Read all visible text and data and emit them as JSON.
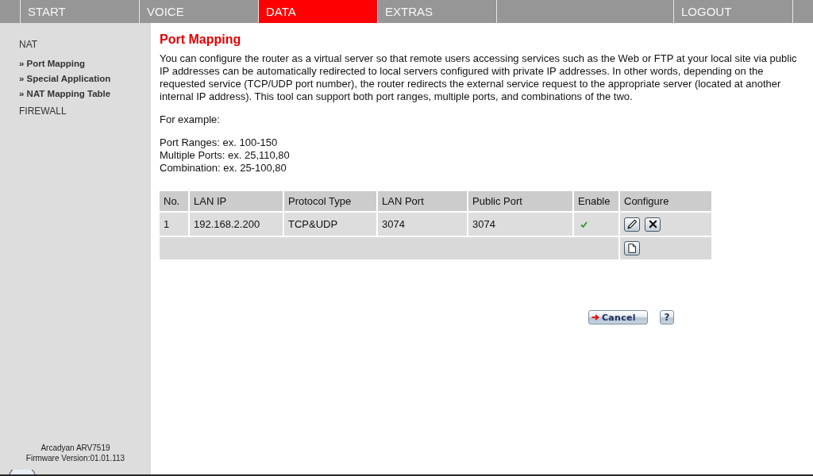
{
  "nav": {
    "tabs": [
      {
        "label": "START",
        "selected": false
      },
      {
        "label": "VOICE",
        "selected": false
      },
      {
        "label": "DATA",
        "selected": true
      },
      {
        "label": "EXTRAS",
        "selected": false
      }
    ],
    "logout": "LOGOUT"
  },
  "sidebar": {
    "sections": [
      {
        "label": "NAT",
        "children": [
          {
            "label": "» Port Mapping"
          },
          {
            "label": "» Special Application"
          },
          {
            "label": "» NAT Mapping Table"
          }
        ]
      },
      {
        "label": "FIREWALL"
      }
    ],
    "device": {
      "model": "Arcadyan ARV7519",
      "firmware": "Firmware Version:01.01.113"
    }
  },
  "content": {
    "title": "Port Mapping",
    "description": "You can configure the router as a virtual server so that remote users accessing services such as the Web or FTP at your local site via public IP addresses can be automatically redirected to local servers configured with private IP addresses. In other words, depending on the requested service (TCP/UDP port number), the router redirects the external service request to the appropriate server (located at another internal IP address). This tool can support both port ranges, multiple ports, and combinations of the two.",
    "example_heading": "For example:",
    "examples": [
      "Port Ranges: ex. 100-150",
      "Multiple Ports: ex. 25,110,80",
      "Combination: ex. 25-100,80"
    ],
    "table": {
      "columns": [
        "No.",
        "LAN IP",
        "Protocol Type",
        "LAN Port",
        "Public Port",
        "Enable",
        "Configure"
      ],
      "rows": [
        {
          "no": "1",
          "lan_ip": "192.168.2.200",
          "protocol": "TCP&UDP",
          "lan_port": "3074",
          "public_port": "3074",
          "enabled": true
        }
      ]
    },
    "buttons": {
      "cancel": "Cancel",
      "help": "?"
    }
  }
}
